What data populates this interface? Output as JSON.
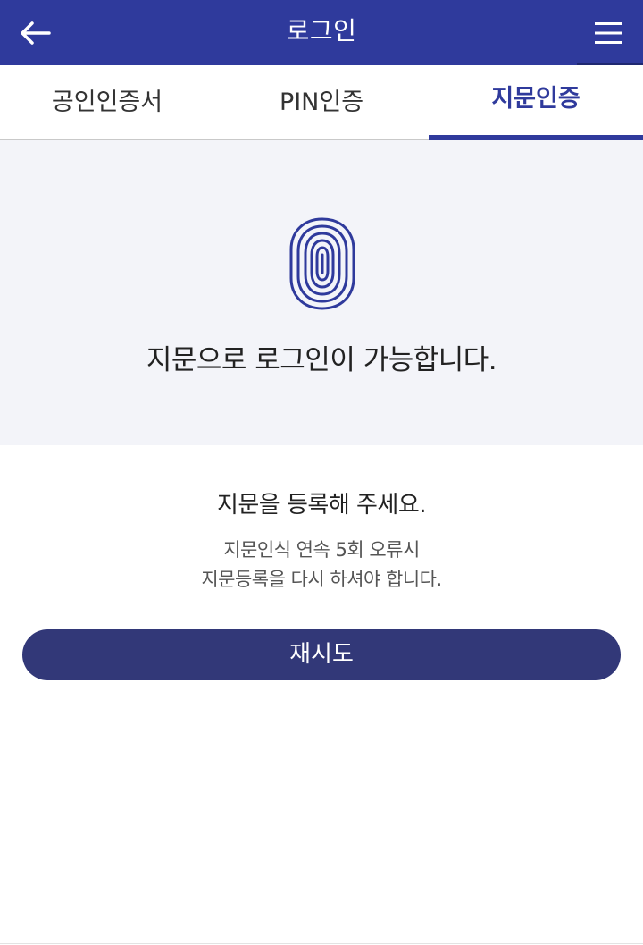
{
  "header": {
    "title": "로그인",
    "back_icon": "arrow-left-icon",
    "menu_icon": "hamburger-menu-icon",
    "color": "#2f3a9c"
  },
  "tabs": [
    {
      "label": "공인인증서",
      "active": false
    },
    {
      "label": "PIN인증",
      "active": false
    },
    {
      "label": "지문인증",
      "active": true
    }
  ],
  "hero": {
    "icon": "fingerprint-icon",
    "message": "지문으로 로그인이 가능합니다."
  },
  "register": {
    "title": "지문을 등록해 주세요.",
    "notice_line1": "지문인식 연속 5회 오류시",
    "notice_line2": "지문등록을 다시 하셔야 합니다."
  },
  "retry_button": {
    "label": "재시도",
    "color": "#323878"
  }
}
